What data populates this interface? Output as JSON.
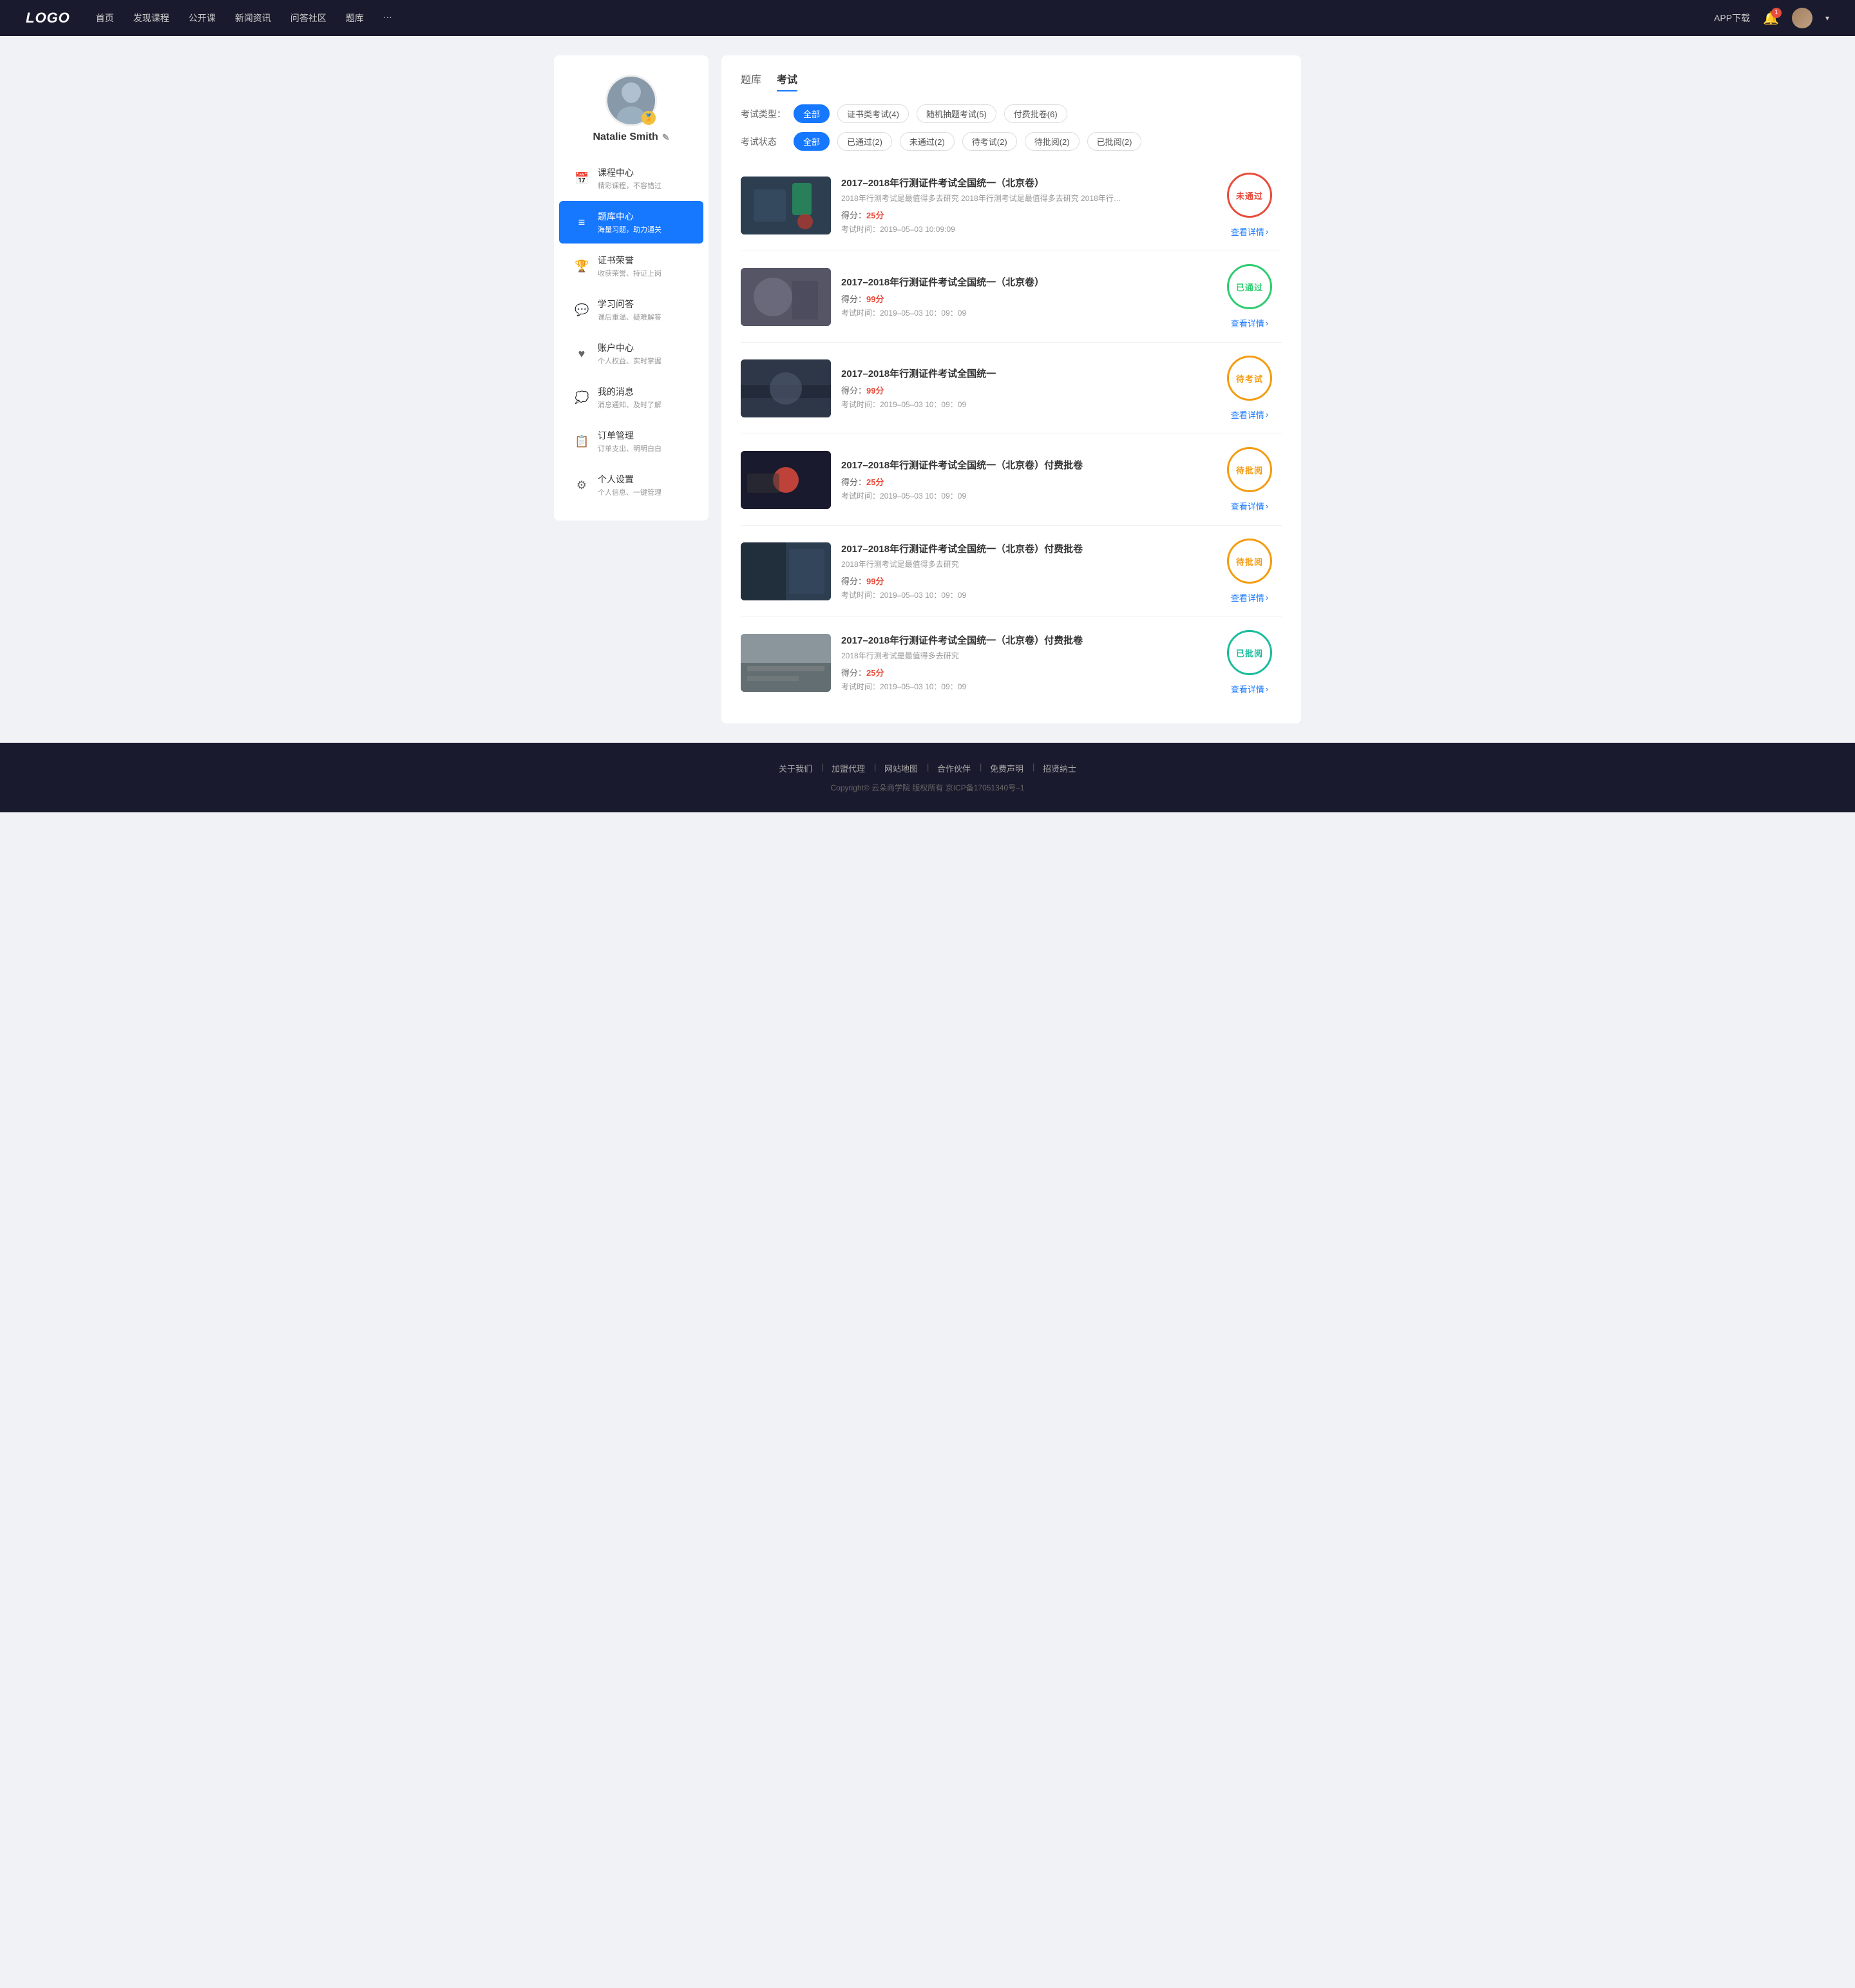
{
  "navbar": {
    "logo": "LOGO",
    "nav_items": [
      "首页",
      "发现课程",
      "公开课",
      "新闻资讯",
      "问答社区",
      "题库",
      "···"
    ],
    "app_download": "APP下载",
    "bell_count": "1",
    "caret": "▾"
  },
  "sidebar": {
    "username": "Natalie Smith",
    "badge_icon": "🏅",
    "edit_icon": "✎",
    "menu_items": [
      {
        "id": "course-center",
        "icon": "📅",
        "title": "课程中心",
        "subtitle": "精彩课程，不容错过"
      },
      {
        "id": "question-bank",
        "icon": "≡",
        "title": "题库中心",
        "subtitle": "海量习题，助力通关",
        "active": true
      },
      {
        "id": "certificate",
        "icon": "👤",
        "title": "证书荣誉",
        "subtitle": "收获荣誉、持证上岗"
      },
      {
        "id": "qa",
        "icon": "💬",
        "title": "学习问答",
        "subtitle": "课后重温、疑难解答"
      },
      {
        "id": "account",
        "icon": "♥",
        "title": "账户中心",
        "subtitle": "个人权益、实时掌握"
      },
      {
        "id": "messages",
        "icon": "💭",
        "title": "我的消息",
        "subtitle": "消息通知、及时了解"
      },
      {
        "id": "orders",
        "icon": "📋",
        "title": "订单管理",
        "subtitle": "订单支出、明明白白"
      },
      {
        "id": "settings",
        "icon": "⚙",
        "title": "个人设置",
        "subtitle": "个人信息、一键管理"
      }
    ]
  },
  "content": {
    "tabs": [
      {
        "id": "question-bank",
        "label": "题库"
      },
      {
        "id": "exam",
        "label": "考试",
        "active": true
      }
    ],
    "type_filters": {
      "label": "考试类型：",
      "items": [
        {
          "label": "全部",
          "active": true
        },
        {
          "label": "证书类考试(4)"
        },
        {
          "label": "随机抽题考试(5)"
        },
        {
          "label": "付费批卷(6)"
        }
      ]
    },
    "status_filters": {
      "label": "考试状态",
      "items": [
        {
          "label": "全部",
          "active": true
        },
        {
          "label": "已通过(2)"
        },
        {
          "label": "未通过(2)"
        },
        {
          "label": "待考试(2)"
        },
        {
          "label": "待批阅(2)"
        },
        {
          "label": "已批阅(2)"
        }
      ]
    },
    "exams": [
      {
        "id": "exam-1",
        "title": "2017–2018年行测证件考试全国统一（北京卷）",
        "desc": "2018年行测考试是最值得多去研究 2018年行测考试是最值得多去研究 2018年行…",
        "score_label": "得分：",
        "score": "25分",
        "score_color": "red",
        "time_label": "考试时间：",
        "time": "2019–05–03  10:09:09",
        "stamp_text": "未通过",
        "stamp_type": "red",
        "detail_label": "查看详情",
        "thumb_class": "thumb-1"
      },
      {
        "id": "exam-2",
        "title": "2017–2018年行测证件考试全国统一（北京卷）",
        "desc": "",
        "score_label": "得分：",
        "score": "99分",
        "score_color": "red",
        "time_label": "考试时间：",
        "time": "2019–05–03  10：09：09",
        "stamp_text": "已通过",
        "stamp_type": "green",
        "detail_label": "查看详情",
        "thumb_class": "thumb-2"
      },
      {
        "id": "exam-3",
        "title": "2017–2018年行测证件考试全国统一",
        "desc": "",
        "score_label": "得分：",
        "score": "99分",
        "score_color": "red",
        "time_label": "考试时间：",
        "time": "2019–05–03  10：09：09",
        "stamp_text": "待考试",
        "stamp_type": "orange",
        "detail_label": "查看详情",
        "thumb_class": "thumb-3"
      },
      {
        "id": "exam-4",
        "title": "2017–2018年行测证件考试全国统一（北京卷）付费批卷",
        "desc": "",
        "score_label": "得分：",
        "score": "25分",
        "score_color": "red",
        "time_label": "考试时间：",
        "time": "2019–05–03  10：09：09",
        "stamp_text": "待批阅",
        "stamp_type": "orange",
        "detail_label": "查看详情",
        "thumb_class": "thumb-4"
      },
      {
        "id": "exam-5",
        "title": "2017–2018年行测证件考试全国统一（北京卷）付费批卷",
        "desc": "2018年行测考试是最值得多去研究",
        "score_label": "得分：",
        "score": "99分",
        "score_color": "red",
        "time_label": "考试时间：",
        "time": "2019–05–03  10：09：09",
        "stamp_text": "待批阅",
        "stamp_type": "orange",
        "detail_label": "查看详情",
        "thumb_class": "thumb-5"
      },
      {
        "id": "exam-6",
        "title": "2017–2018年行测证件考试全国统一（北京卷）付费批卷",
        "desc": "2018年行测考试是最值得多去研究",
        "score_label": "得分：",
        "score": "25分",
        "score_color": "red",
        "time_label": "考试时间：",
        "time": "2019–05–03  10：09：09",
        "stamp_text": "已批阅",
        "stamp_type": "teal",
        "detail_label": "查看详情",
        "thumb_class": "thumb-6"
      }
    ]
  },
  "footer": {
    "links": [
      "关于我们",
      "加盟代理",
      "网站地图",
      "合作伙伴",
      "免费声明",
      "招贤纳士"
    ],
    "copyright": "Copyright© 云朵商学院  版权所有    京ICP备17051340号–1"
  }
}
